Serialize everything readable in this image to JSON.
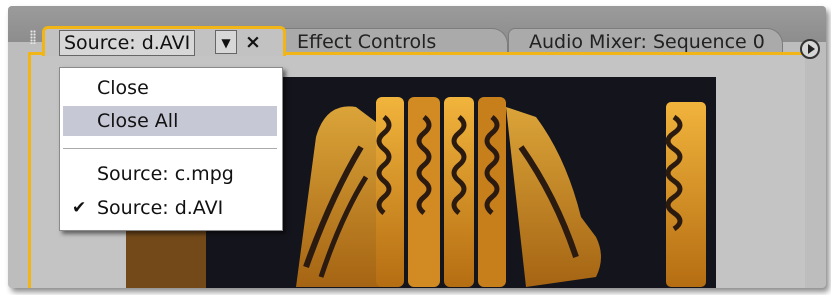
{
  "tabs": {
    "source": {
      "label": "Source: d.AVI",
      "dropdown_glyph": "▼",
      "close_glyph": "×"
    },
    "effect_controls": {
      "label": "Effect Controls"
    },
    "audio_mixer": {
      "label": "Audio Mixer: Sequence 0"
    }
  },
  "menu": {
    "items": [
      {
        "label": "Close",
        "highlighted": false
      },
      {
        "label": "Close All",
        "highlighted": true
      },
      {
        "label": "Source: c.mpg",
        "checked": false
      },
      {
        "label": "Source: d.AVI",
        "checked": true
      }
    ],
    "check_glyph": "✔"
  },
  "icons": {
    "flyout": "panel-menu-icon",
    "grip": "drag-grip-icon",
    "dropdown": "chevron-down-icon",
    "close": "close-icon"
  },
  "colors": {
    "accent_border": "#f1b616",
    "menu_highlight": "#c6c8d6",
    "panel_bg": "#c4c4c4",
    "tab_bar_bg": "#9b9b9b"
  }
}
